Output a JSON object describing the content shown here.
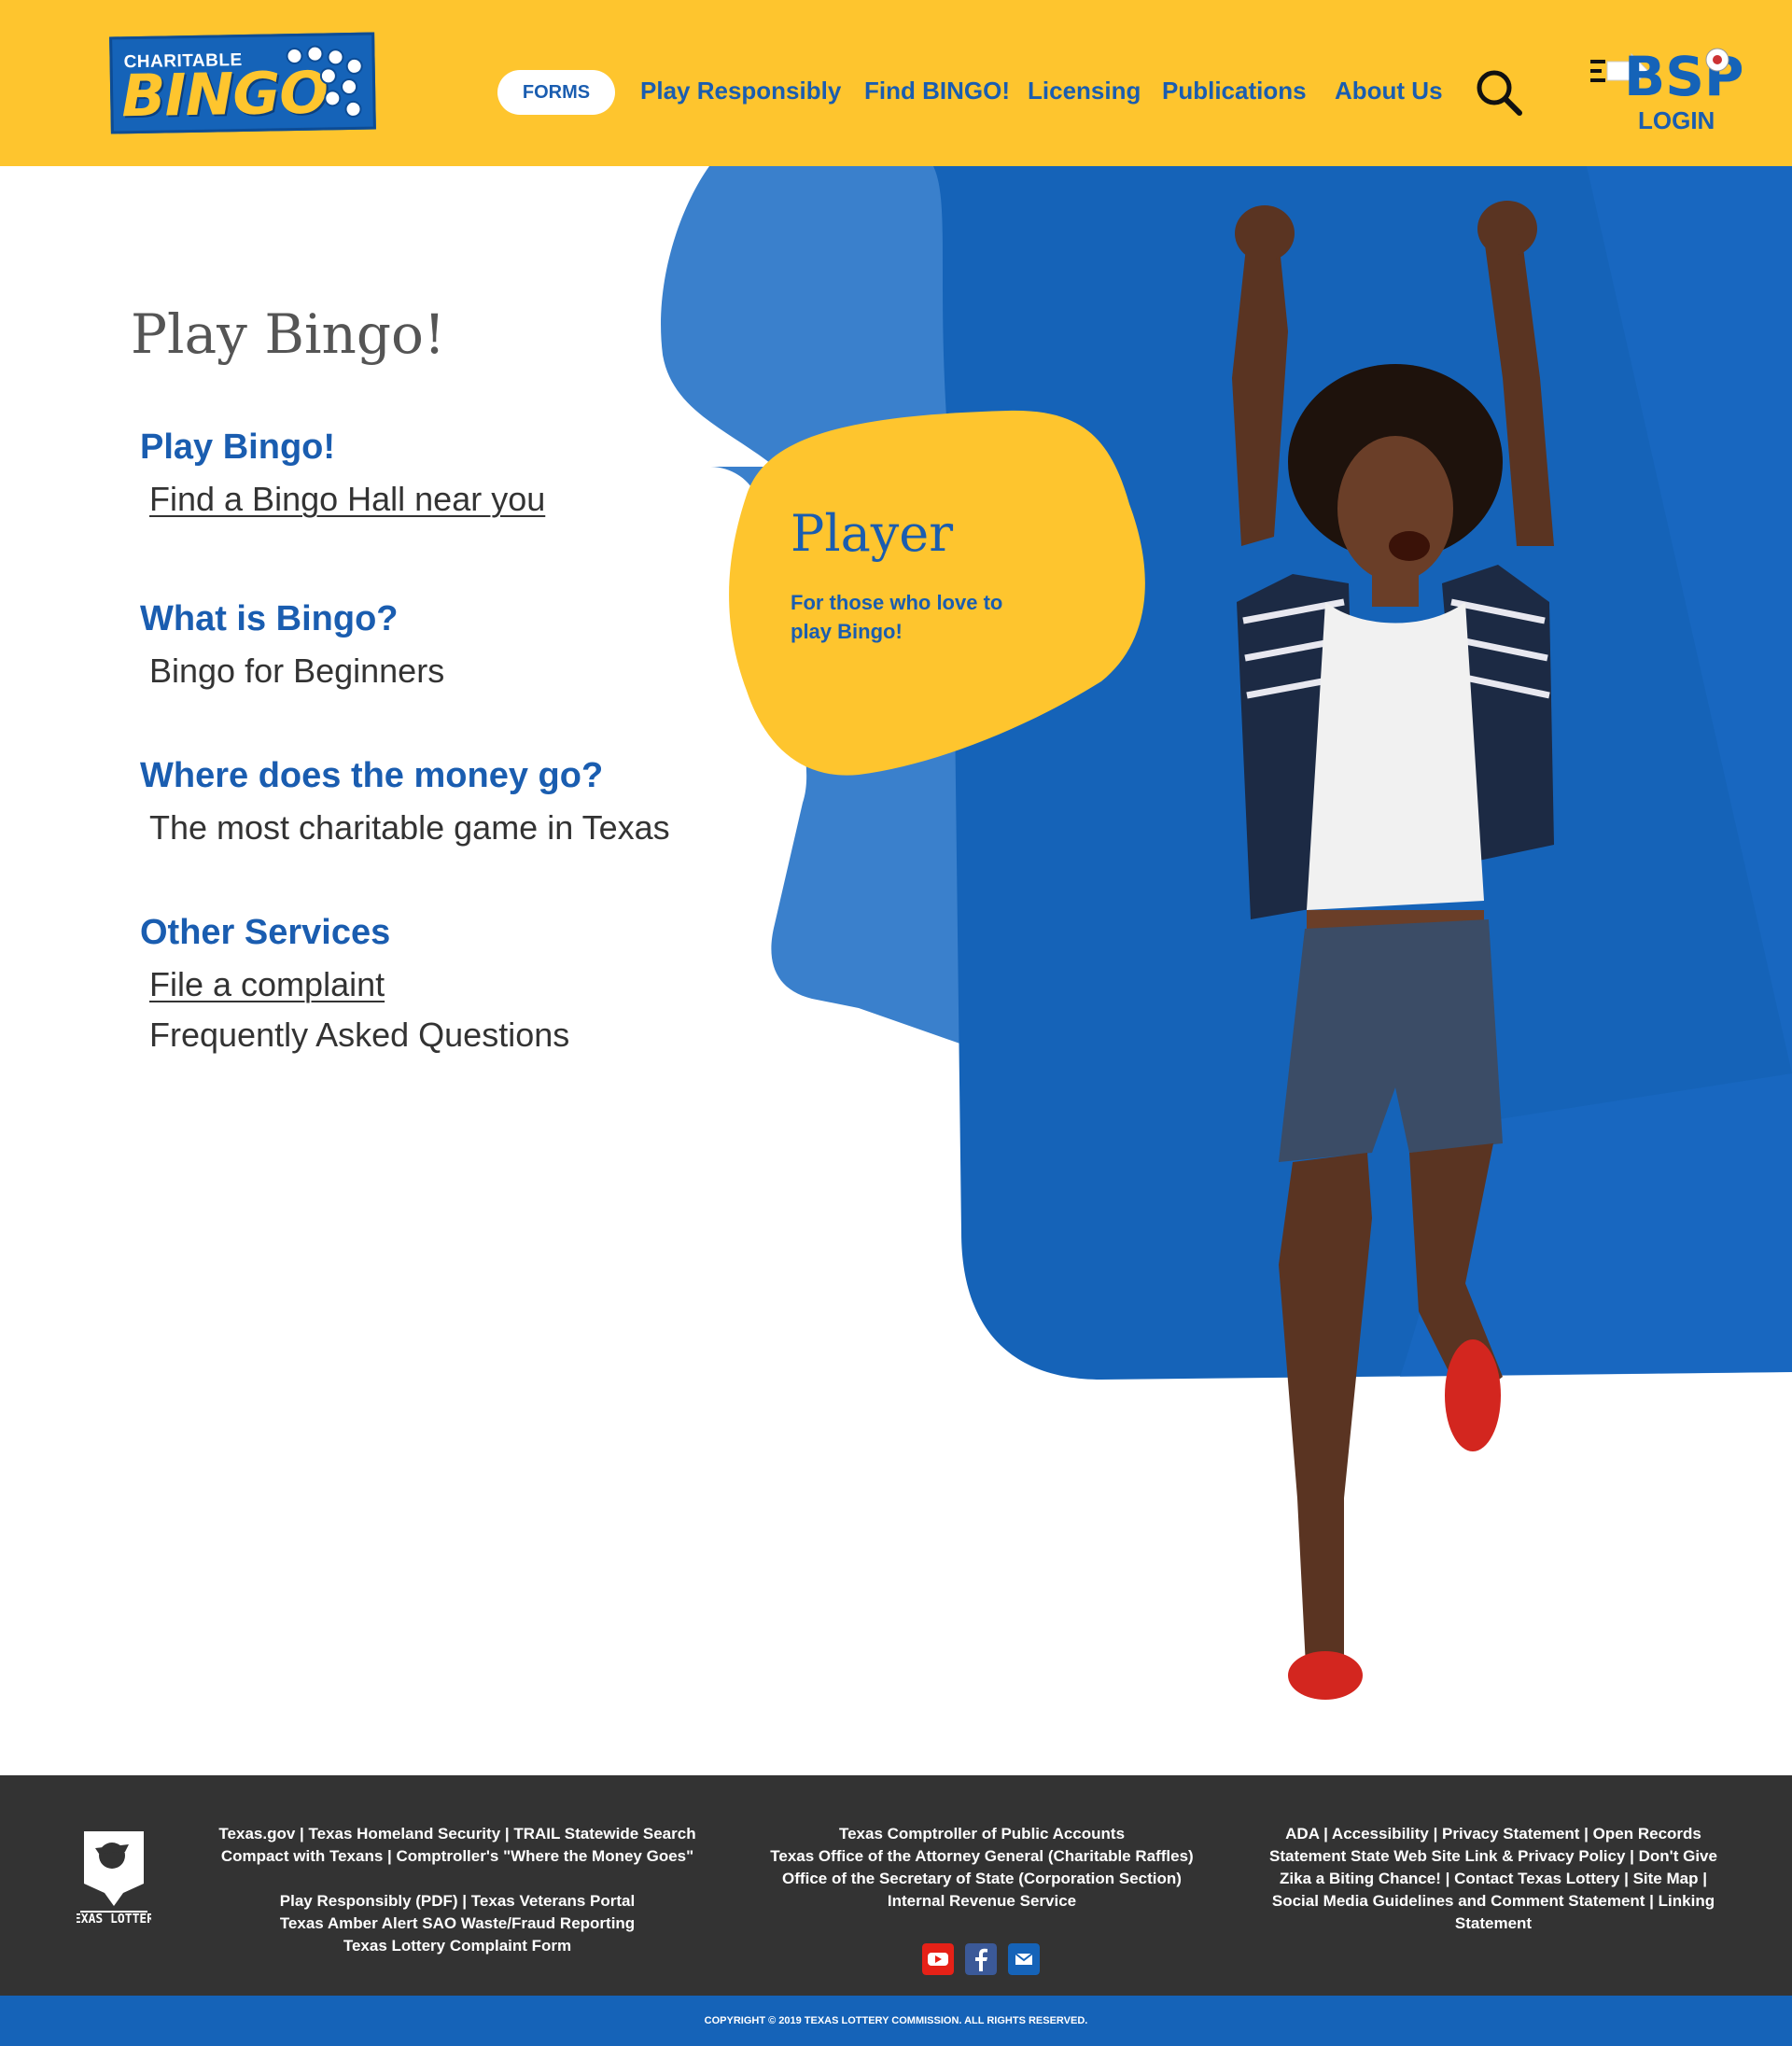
{
  "header": {
    "logo": {
      "top_text": "CHARITABLE",
      "main_text": "BINGO"
    },
    "nav": {
      "forms": "FORMS",
      "play_responsibly": "Play Responsibly",
      "find_bingo": "Find BINGO!",
      "licensing": "Licensing",
      "publications": "Publications",
      "about_us": "About Us"
    },
    "login": "LOGIN",
    "bsp_text": "BSP"
  },
  "main": {
    "page_title": "Play Bingo!",
    "sections": [
      {
        "heading": "Play Bingo!",
        "links": [
          "Find a Bingo Hall near you"
        ]
      },
      {
        "heading": "What is Bingo?",
        "links": [
          "Bingo for Beginners"
        ]
      },
      {
        "heading": "Where does the money go?",
        "links": [
          "The most charitable game in Texas"
        ]
      },
      {
        "heading": "Other Services",
        "links": [
          "File a complaint",
          "Frequently Asked Questions"
        ]
      }
    ],
    "player_card": {
      "title": "Player",
      "subtitle": "For those who love to play Bingo!"
    }
  },
  "footer": {
    "col1": [
      "Texas.gov | Texas Homeland Security | TRAIL Statewide Search",
      "Compact with Texans | Comptroller's \"Where the Money Goes\"",
      "",
      "Play Responsibly (PDF) | Texas Veterans Portal",
      "Texas Amber Alert SAO Waste/Fraud Reporting",
      "Texas Lottery Complaint Form"
    ],
    "col2": [
      "Texas Comptroller of Public Accounts",
      "Texas Office of the Attorney General (Charitable Raffles)",
      "Office of the Secretary of State (Corporation Section)",
      "Internal Revenue Service"
    ],
    "col3": [
      "ADA | Accessibility | Privacy Statement | Open Records",
      "Statement State Web Site Link & Privacy Policy | Don't Give",
      "Zika a Biting Chance! | Contact Texas Lottery | Site Map |",
      "Social Media Guidelines and Comment Statement | Linking",
      "Statement"
    ],
    "tl_logo_text": "TEXAS LOTTERY",
    "copyright": "COPYRIGHT © 2019 TEXAS LOTTERY COMMISSION. ALL RIGHTS RESERVED."
  },
  "colors": {
    "yellow": "#fec52e",
    "blue": "#1563b8",
    "light_blue": "#3a80cc",
    "footer_dark": "#333333"
  }
}
